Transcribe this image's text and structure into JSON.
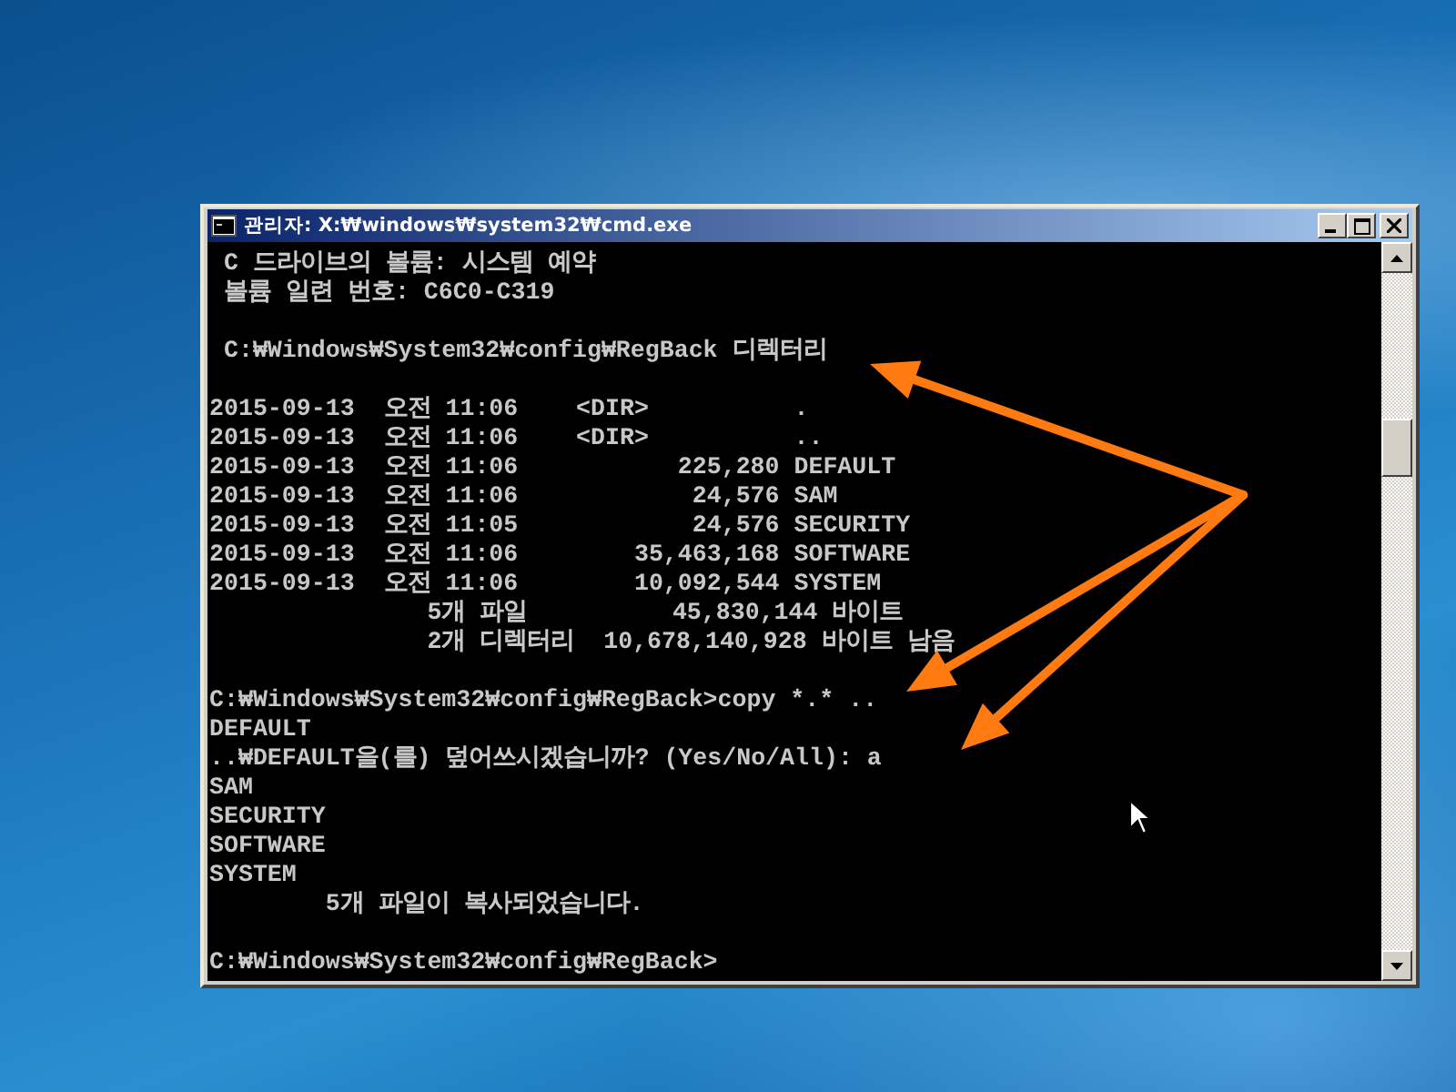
{
  "window": {
    "title": "관리자: X:₩windows₩system32₩cmd.exe"
  },
  "console": {
    "lines": [
      {
        "text": " C 드라이브의 볼륨: 시스템 예약",
        "gap_before": false
      },
      {
        "text": " 볼륨 일련 번호: C6C0-C319",
        "gap_before": false
      },
      {
        "text": " C:₩Windows₩System32₩config₩RegBack 디렉터리",
        "gap_before": true
      },
      {
        "text": "2015-09-13  오전 11:06    <DIR>          .",
        "gap_before": true
      },
      {
        "text": "2015-09-13  오전 11:06    <DIR>          ..",
        "gap_before": false
      },
      {
        "text": "2015-09-13  오전 11:06           225,280 DEFAULT",
        "gap_before": false
      },
      {
        "text": "2015-09-13  오전 11:06            24,576 SAM",
        "gap_before": false
      },
      {
        "text": "2015-09-13  오전 11:05            24,576 SECURITY",
        "gap_before": false
      },
      {
        "text": "2015-09-13  오전 11:06        35,463,168 SOFTWARE",
        "gap_before": false
      },
      {
        "text": "2015-09-13  오전 11:06        10,092,544 SYSTEM",
        "gap_before": false
      },
      {
        "text": "               5개 파일          45,830,144 바이트",
        "gap_before": false
      },
      {
        "text": "               2개 디렉터리  10,678,140,928 바이트 남음",
        "gap_before": false
      },
      {
        "text": "C:₩Windows₩System32₩config₩RegBack>copy *.* ..",
        "gap_before": true
      },
      {
        "text": "DEFAULT",
        "gap_before": false
      },
      {
        "text": "..₩DEFAULT을(를) 덮어쓰시겠습니까? (Yes/No/All): a",
        "gap_before": false
      },
      {
        "text": "SAM",
        "gap_before": false
      },
      {
        "text": "SECURITY",
        "gap_before": false
      },
      {
        "text": "SOFTWARE",
        "gap_before": false
      },
      {
        "text": "SYSTEM",
        "gap_before": false
      },
      {
        "text": "        5개 파일이 복사되었습니다.",
        "gap_before": false
      },
      {
        "text": "C:₩Windows₩System32₩config₩RegBack>",
        "gap_before": true
      }
    ]
  }
}
